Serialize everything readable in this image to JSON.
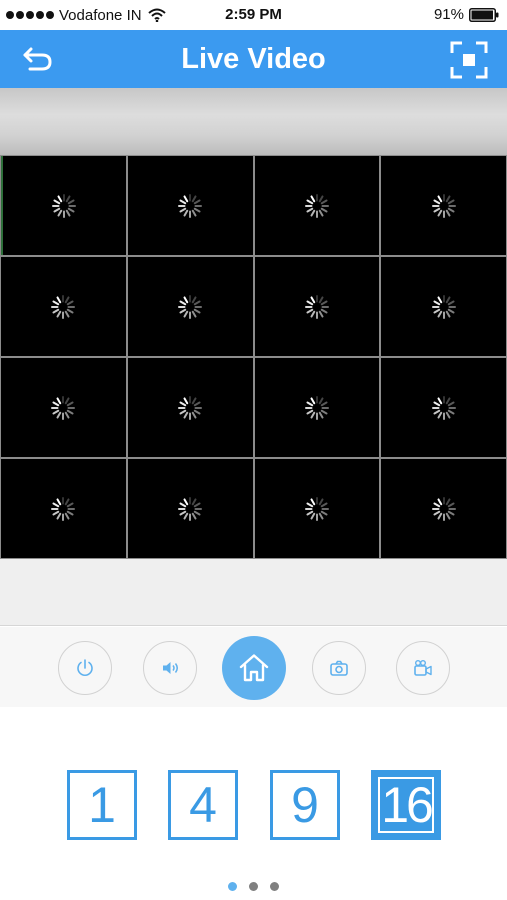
{
  "status_bar": {
    "carrier": "Vodafone IN",
    "time": "2:59 PM",
    "battery": "91%",
    "icons": [
      "signal-dots-icon",
      "wifi-icon",
      "battery-icon"
    ]
  },
  "nav": {
    "title": "Live Video",
    "back_icon": "back-arrow-icon",
    "fullscreen_icon": "fullscreen-icon"
  },
  "video_grid": {
    "rows": 4,
    "columns": 4,
    "cell_state": "loading",
    "cell_icon": "loading-spinner-icon"
  },
  "controls": [
    {
      "name": "power-button",
      "icon": "power-icon"
    },
    {
      "name": "audio-button",
      "icon": "speaker-icon"
    },
    {
      "name": "home-button",
      "icon": "home-icon",
      "highlighted": true
    },
    {
      "name": "snapshot-button",
      "icon": "camera-icon"
    },
    {
      "name": "record-button",
      "icon": "video-camera-icon"
    }
  ],
  "layouts": [
    {
      "label": "1",
      "selected": false
    },
    {
      "label": "4",
      "selected": false
    },
    {
      "label": "9",
      "selected": false
    },
    {
      "label": "16",
      "selected": true
    }
  ],
  "pagination": {
    "pages": 3,
    "current_page": 1
  },
  "colors": {
    "accent": "#3b9af0",
    "home_button": "#5fb1ee",
    "layout_blue": "#3a9ae4",
    "video_bg": "#000000"
  }
}
